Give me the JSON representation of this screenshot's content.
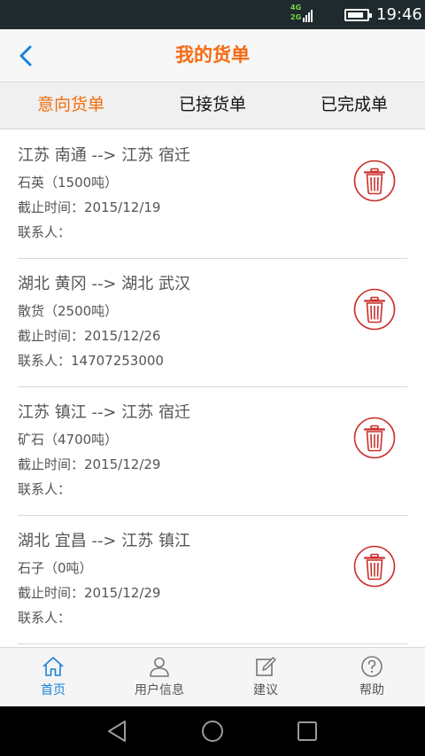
{
  "status_bar": {
    "network_top": "4G",
    "network_bottom": "2G",
    "time": "19:46",
    "battery_level": 0.85
  },
  "header": {
    "back_icon": "chevron-left-icon",
    "title": "我的货单"
  },
  "tabs": [
    {
      "label": "意向货单",
      "active": true
    },
    {
      "label": "已接货单",
      "active": false
    },
    {
      "label": "已完成单",
      "active": false
    }
  ],
  "orders": [
    {
      "route": "江苏 南通 --> 江苏 宿迁",
      "goods": "石英（1500吨）",
      "deadline": "截止时间：2015/12/19",
      "contact": "联系人："
    },
    {
      "route": "湖北 黄冈 --> 湖北 武汉",
      "goods": "散货（2500吨）",
      "deadline": "截止时间：2015/12/26",
      "contact": "联系人：14707253000"
    },
    {
      "route": "江苏 镇江 --> 江苏 宿迁",
      "goods": "矿石（4700吨）",
      "deadline": "截止时间：2015/12/29",
      "contact": "联系人："
    },
    {
      "route": "湖北 宜昌 --> 江苏 镇江",
      "goods": "石子（0吨）",
      "deadline": "截止时间：2015/12/29",
      "contact": "联系人："
    }
  ],
  "bottom_nav": [
    {
      "label": "首页",
      "icon": "home-icon",
      "active": true
    },
    {
      "label": "用户信息",
      "icon": "user-icon",
      "active": false
    },
    {
      "label": "建议",
      "icon": "edit-icon",
      "active": false
    },
    {
      "label": "帮助",
      "icon": "help-icon",
      "active": false
    }
  ],
  "colors": {
    "accent_orange": "#f56a12",
    "delete_red": "#c9302c",
    "nav_active_blue": "#1a82d6",
    "status_bar_bg": "#1e2a2d"
  }
}
